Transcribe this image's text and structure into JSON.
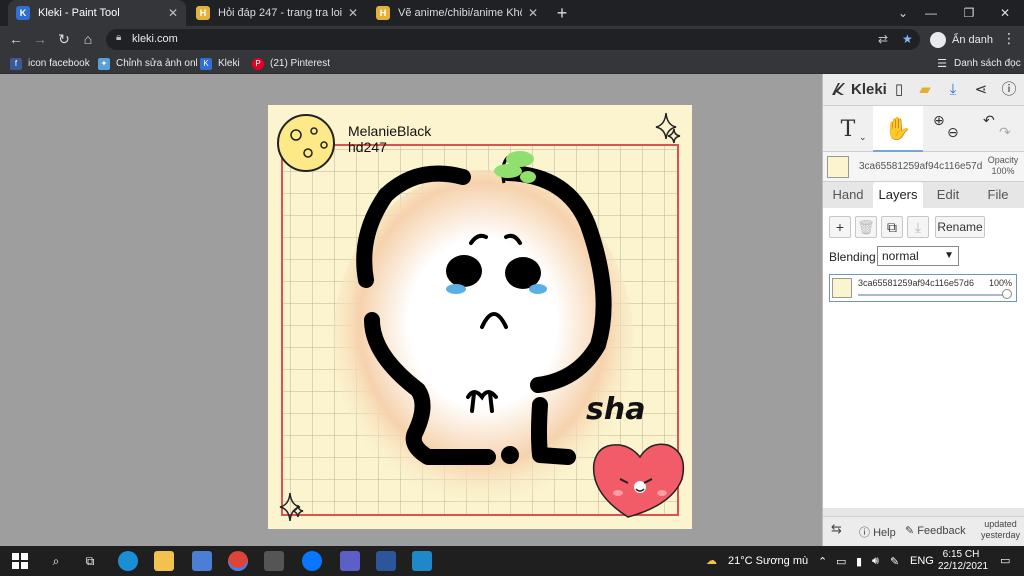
{
  "browser": {
    "tabs": [
      {
        "title": "Kleki - Paint Tool",
        "favicon": "K",
        "color": "#2f6fd6",
        "active": true
      },
      {
        "title": "Hỏi đáp 247 - trang tra loi",
        "favicon": "H",
        "color": "#e2b23b",
        "active": false
      },
      {
        "title": "Vẽ anime/chibi/anime Không ph",
        "favicon": "H",
        "color": "#e2b23b",
        "active": false
      }
    ],
    "url": "kleki.com",
    "profile_label": "Ẩn danh",
    "bookmarks": [
      {
        "label": "icon facebook"
      },
      {
        "label": "Chỉnh sửa ảnh onl"
      },
      {
        "label": "Kleki"
      },
      {
        "label": "(21) Pinterest"
      }
    ],
    "reading_list_label": "Danh sách đọc"
  },
  "canvas": {
    "signature_line1": "MelanieBlack",
    "signature_line2": "hd247",
    "drawn_text": "sha"
  },
  "kleki": {
    "logo": "Kleki",
    "tools": [
      {
        "name": "text-tool",
        "glyph": "T"
      },
      {
        "name": "hand-tool",
        "glyph": "✋"
      }
    ],
    "layer_name": "3ca65581259af94c116e57d",
    "opacity_label": "Opacity",
    "opacity_value": "100%",
    "tabs": [
      "Hand",
      "Layers",
      "Edit",
      "File"
    ],
    "active_tab": "Layers",
    "rename_label": "Rename",
    "blending_label": "Blending",
    "blending_value": "normal",
    "layer_row_name": "3ca65581259af94c116e57d6",
    "layer_row_opacity": "100%",
    "layer_row_opacity_fraction": 1.0,
    "footer": {
      "help": "Help",
      "feedback": "Feedback",
      "updated_line1": "updated",
      "updated_line2": "yesterday"
    }
  },
  "taskbar": {
    "weather": "21°C  Sương mù",
    "language": "ENG",
    "time": "6:15 CH",
    "date": "22/12/2021"
  }
}
